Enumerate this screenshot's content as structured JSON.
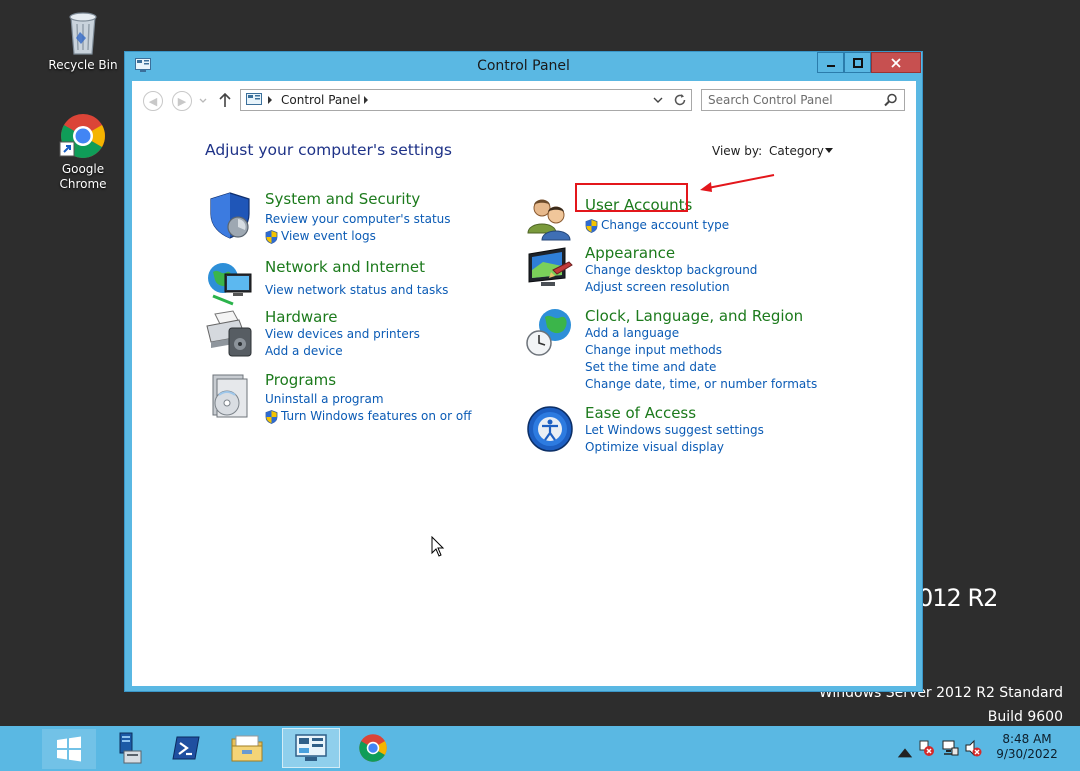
{
  "desktop": {
    "recycle_bin": "Recycle Bin",
    "chrome": "Google Chrome",
    "watermark_fragment": "012 R2",
    "watermark_edition": "Windows Server 2012 R2 Standard",
    "watermark_build": "Build 9600"
  },
  "window": {
    "title": "Control Panel",
    "breadcrumb": "Control Panel",
    "search_placeholder": "Search Control Panel",
    "heading": "Adjust your computer's settings",
    "view_by_label": "View by:",
    "view_by_value": "Category"
  },
  "categories": [
    {
      "title": "System and Security",
      "links": [
        "Review your computer's status",
        "View event logs"
      ]
    },
    {
      "title": "Network and Internet",
      "links": [
        "View network status and tasks"
      ]
    },
    {
      "title": "Hardware",
      "links": [
        "View devices and printers",
        "Add a device"
      ]
    },
    {
      "title": "Programs",
      "links": [
        "Uninstall a program",
        "Turn Windows features on or off"
      ]
    },
    {
      "title": "User Accounts",
      "links": [
        "Change account type"
      ]
    },
    {
      "title": "Appearance",
      "links": [
        "Change desktop background",
        "Adjust screen resolution"
      ]
    },
    {
      "title": "Clock, Language, and Region",
      "links": [
        "Add a language",
        "Change input methods",
        "Set the time and date",
        "Change date, time, or number formats"
      ]
    },
    {
      "title": "Ease of Access",
      "links": [
        "Let Windows suggest settings",
        "Optimize visual display"
      ]
    }
  ],
  "taskbar": {
    "items": [
      "start-icon",
      "server-manager-icon",
      "powershell-icon",
      "file-explorer-icon",
      "control-panel-icon",
      "chrome-icon"
    ],
    "time": "8:48 AM",
    "date": "9/30/2022"
  },
  "colors": {
    "accent": "#5ab8e3",
    "link": "#0b5bb5",
    "category_title": "#1c7a1c",
    "heading": "#1e3287",
    "highlight": "#e3161b",
    "close_button": "#c75050"
  }
}
